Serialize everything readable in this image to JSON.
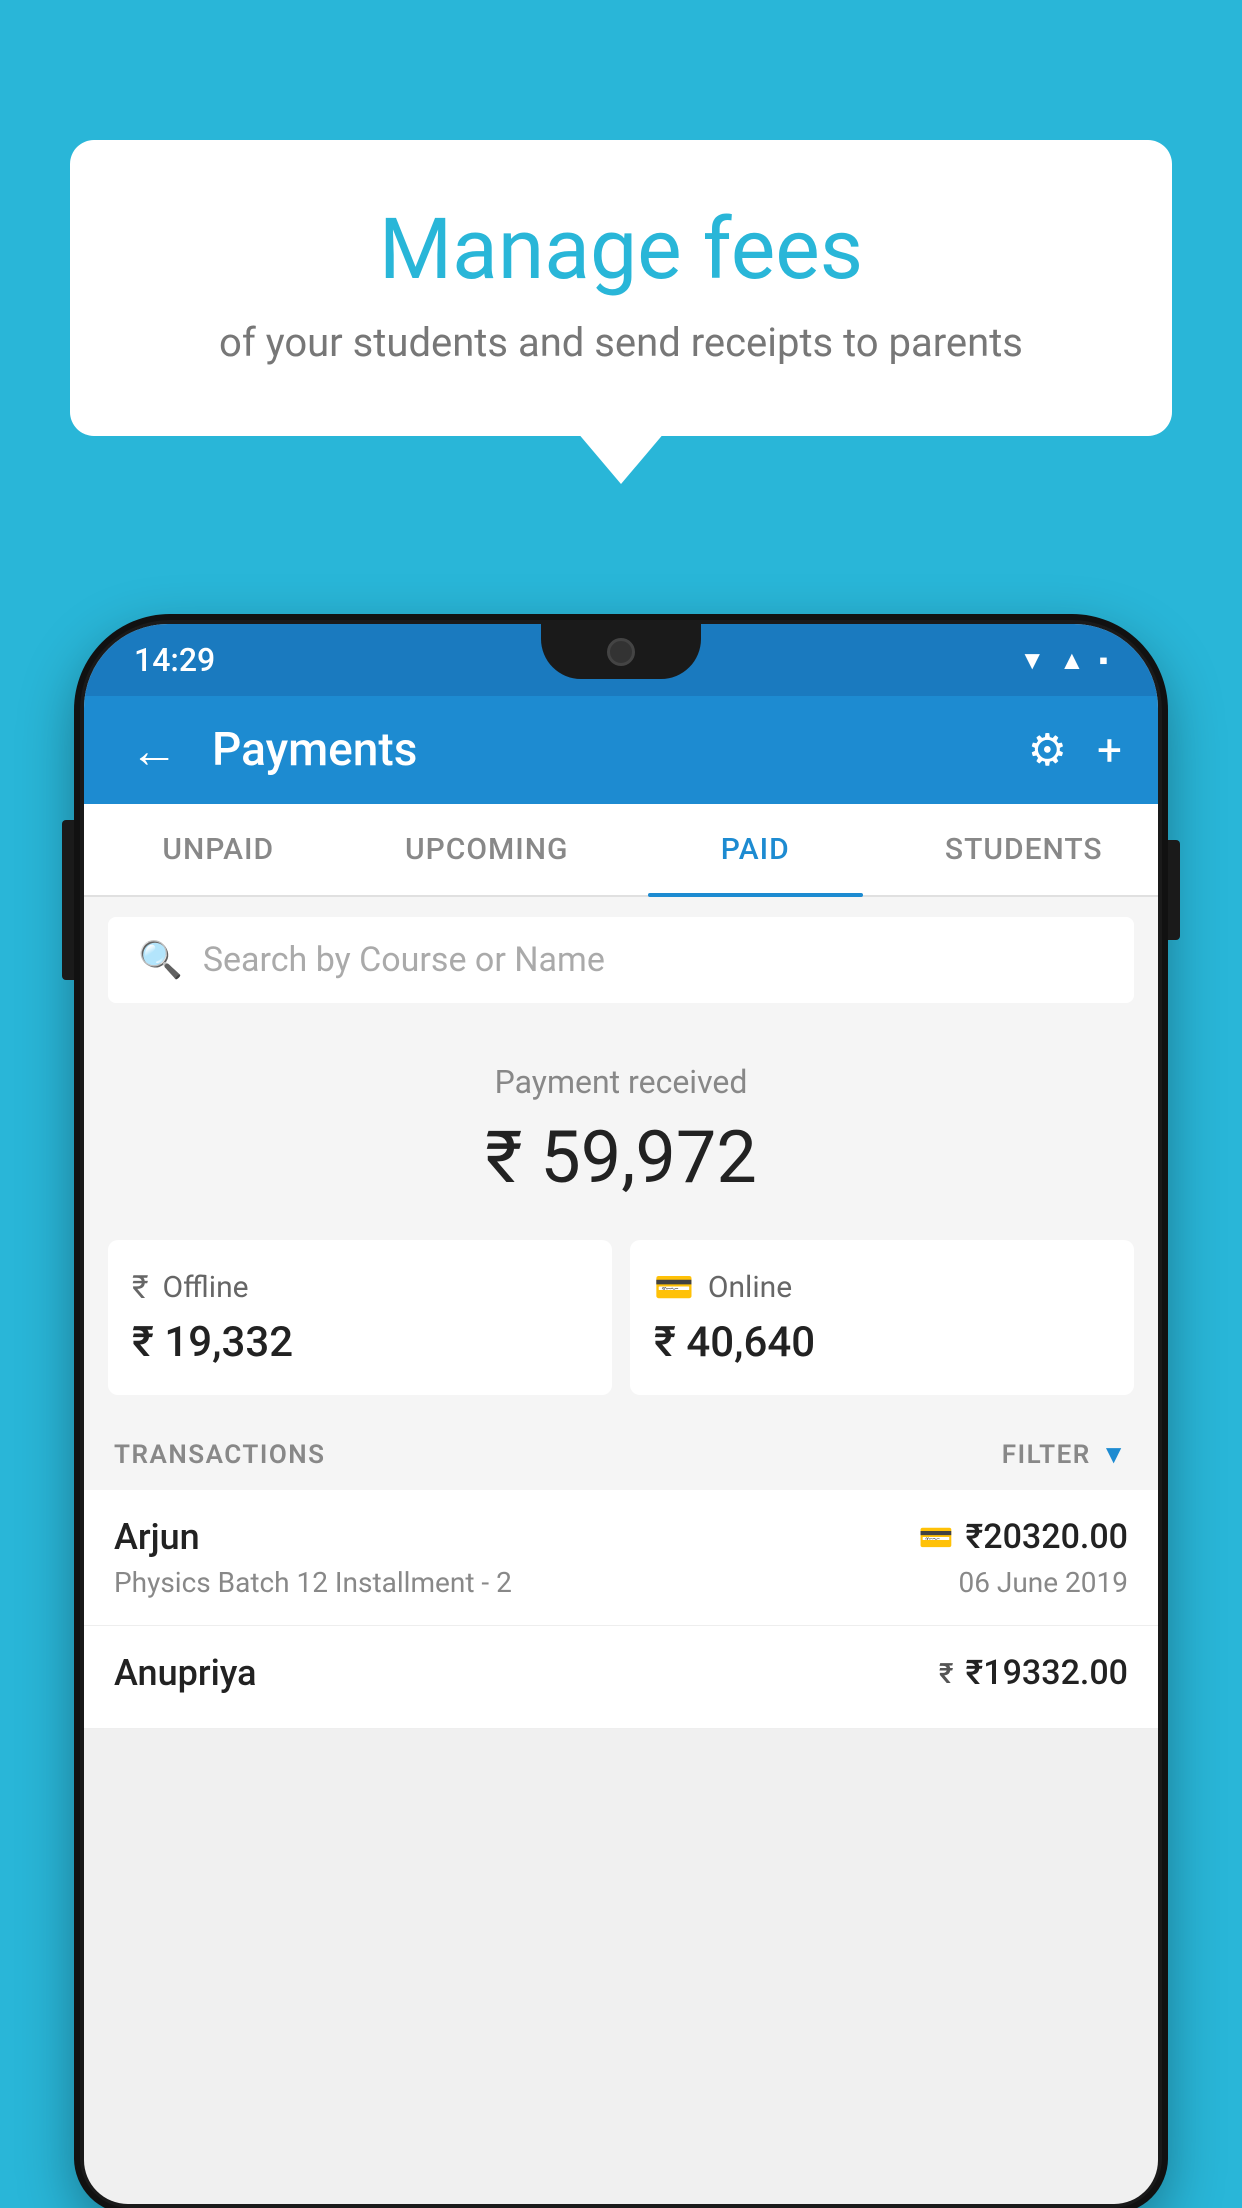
{
  "page": {
    "background_color": "#29b6d8"
  },
  "bubble": {
    "title": "Manage fees",
    "subtitle": "of your students and send receipts to parents"
  },
  "status_bar": {
    "time": "14:29",
    "icons": [
      "wifi",
      "signal",
      "battery"
    ]
  },
  "app_bar": {
    "back_icon": "←",
    "title": "Payments",
    "settings_icon": "⚙",
    "add_icon": "+"
  },
  "tabs": [
    {
      "label": "UNPAID",
      "active": false
    },
    {
      "label": "UPCOMING",
      "active": false
    },
    {
      "label": "PAID",
      "active": true
    },
    {
      "label": "STUDENTS",
      "active": false
    }
  ],
  "search": {
    "placeholder": "Search by Course or Name"
  },
  "payment_summary": {
    "label": "Payment received",
    "amount": "₹ 59,972"
  },
  "payment_cards": [
    {
      "mode_icon": "₹",
      "mode_label": "Offline",
      "amount": "₹ 19,332"
    },
    {
      "mode_icon": "💳",
      "mode_label": "Online",
      "amount": "₹ 40,640"
    }
  ],
  "transactions_section": {
    "label": "TRANSACTIONS",
    "filter_label": "FILTER"
  },
  "transactions": [
    {
      "name": "Arjun",
      "course": "Physics Batch 12 Installment - 2",
      "amount": "₹20320.00",
      "date": "06 June 2019",
      "mode": "online"
    },
    {
      "name": "Anupriya",
      "course": "",
      "amount": "₹19332.00",
      "date": "",
      "mode": "offline"
    }
  ]
}
